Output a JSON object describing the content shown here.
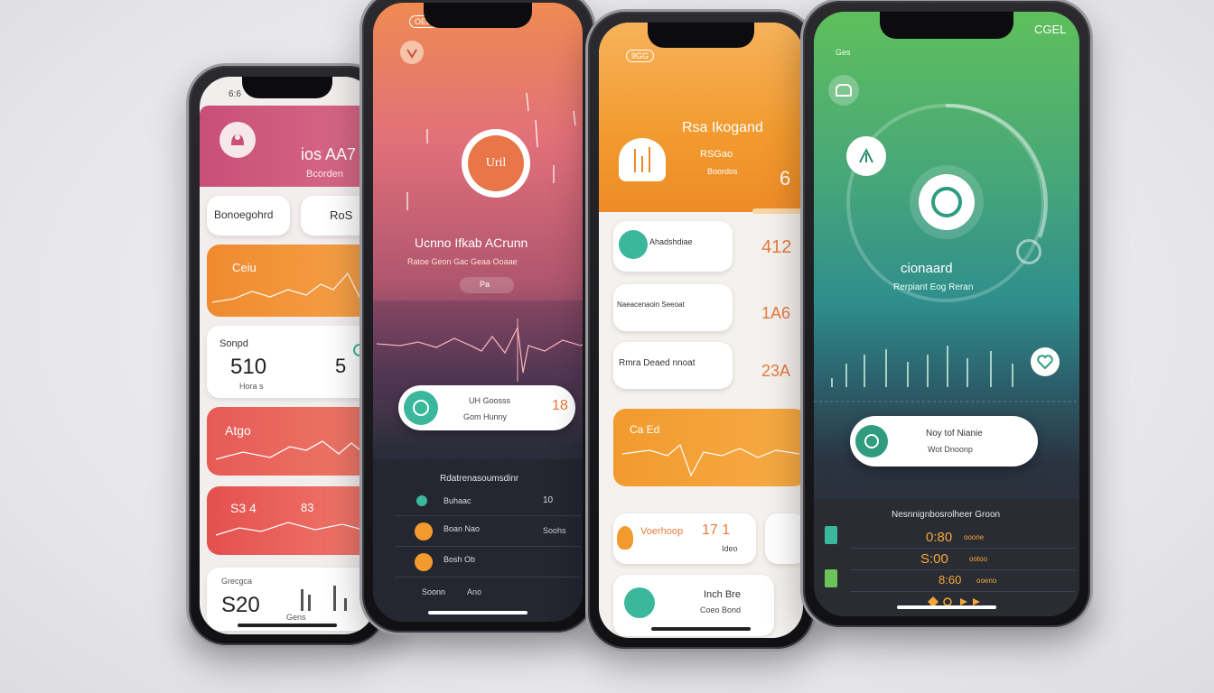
{
  "colors": {
    "pink": "#c84a6e",
    "orange": "#f39a2c",
    "coral": "#e45a55",
    "teal": "#3bb89c",
    "green": "#6cc35a",
    "dark": "#2c2f3a"
  },
  "phone1": {
    "status_time": "6:6",
    "header_title": "ios AA7",
    "header_sub": "Bcorden",
    "pill_left": "Bonoegohrd",
    "pill_right": "RoS",
    "orange_card_title": "Ceiu",
    "stat_title": "Sonpd",
    "stat_value": "510",
    "stat_side": "5",
    "stat_foot": "Hora s",
    "coral_card_title": "Atgo",
    "coral_card2_value": "S3 4",
    "coral_card2_side": "83",
    "bottom_label": "Grecgca",
    "bottom_value": "S20",
    "bottom_chart_label": "Gens"
  },
  "phone2": {
    "status_badge": "OEG",
    "title": "Ucnno Ifkab ACrunn",
    "subtitle": "Ratoe Geon Gac Geaa Ooaae",
    "logo_text": "Uril",
    "tab_label": "Pa",
    "pill_line1": "UH Goosss",
    "pill_line2": "Gom Hunny",
    "pill_value": "18",
    "section_title": "Rdatrenasoumsdinr",
    "rows": [
      {
        "label": "Buhaac",
        "value": "10"
      },
      {
        "label": "Boan Nao",
        "value": "Soohs"
      },
      {
        "label": "Bosh Ob",
        "value": ""
      },
      {
        "label": "Soonn",
        "value": "Ano"
      }
    ]
  },
  "phone3": {
    "status_badge": "9GG",
    "title": "Rsa Ikogand",
    "subtitle": "RSGao",
    "sub2": "Boordos",
    "number": "6",
    "rows": [
      {
        "label": "Ahadshdiae",
        "value": "412"
      },
      {
        "label": "Naeacenaoin Seeoat",
        "value": "1A6"
      },
      {
        "label": "Rmra Deaed nnoat",
        "value": "23A"
      }
    ],
    "orange_card_title": "Ca Ed",
    "bottom_label": "Voerhoop",
    "bottom_value": "17 1",
    "bottom_side": "Ideo",
    "bottom_card2_line1": "Inch Bre",
    "bottom_card2_line2": "Coeo Bond"
  },
  "phone4": {
    "status_left": "Ges",
    "status_right": "CGEL",
    "title": "cionaard",
    "subtitle": "Rerpiant Eog Reran",
    "pill_line1": "Noy tof Nianie",
    "pill_line2": "Wot Dnoonp",
    "section_title": "Nesnnignbosrolheer Groon",
    "rows": [
      {
        "value": "0:80",
        "suffix": "ooone"
      },
      {
        "value": "S:00",
        "suffix": "ootoo"
      },
      {
        "value": "8:60",
        "suffix": "ooeno"
      }
    ]
  }
}
